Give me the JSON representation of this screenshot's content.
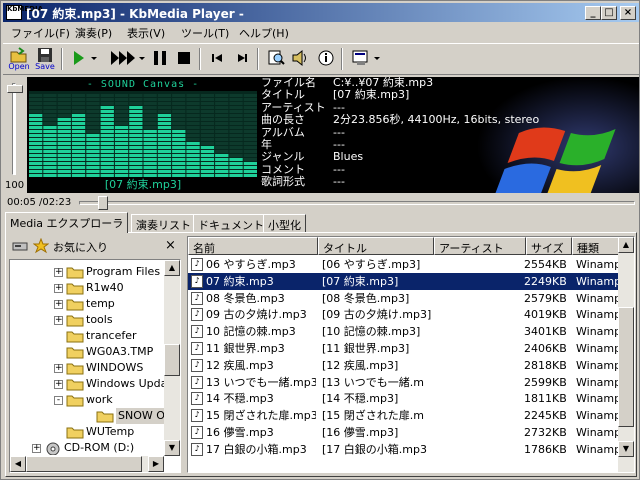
{
  "window": {
    "title": "[07 約束.mp3] - KbMedia Player -",
    "icon_text": "KbMEDIA",
    "buttons": {
      "minimize": "_",
      "maximize": "□",
      "close": "×"
    }
  },
  "menu": [
    "ファイル(F)",
    "演奏(P)",
    "表示(V)",
    "ツール(T)",
    "ヘルプ(H)"
  ],
  "toolbar": {
    "open_label": "Open",
    "save_label": "Save",
    "icons": [
      "open-folder-icon",
      "save-disk-icon",
      "play-icon",
      "fast-forward-icon",
      "pause-icon",
      "stop-icon",
      "previous-track-icon",
      "next-track-icon",
      "search-file-icon",
      "speaker-icon",
      "info-icon",
      "dropdown-menu-icon"
    ]
  },
  "volume": {
    "level_label": "100",
    "level": 1.0
  },
  "visualizer": {
    "title": "- SOUND Canvas -",
    "track": "[07 約束.mp3]",
    "bar_color": "#1fd19a",
    "bars": [
      0.78,
      0.62,
      0.7,
      0.78,
      0.5,
      0.86,
      0.62,
      0.86,
      0.58,
      0.78,
      0.58,
      0.44,
      0.36,
      0.3,
      0.22,
      0.18
    ]
  },
  "info": {
    "rows": [
      {
        "key": "ファイル名",
        "value": "C:¥..¥07 約束.mp3"
      },
      {
        "key": "タイトル",
        "value": "[07 約束.mp3]"
      },
      {
        "key": "アーティスト",
        "value": "---"
      },
      {
        "key": "曲の長さ",
        "value": "2分23.856秒, 44100Hz, 16bits, stereo"
      },
      {
        "key": "アルバム",
        "value": "---"
      },
      {
        "key": "年",
        "value": "---"
      },
      {
        "key": "ジャンル",
        "value": "Blues"
      },
      {
        "key": "コメント",
        "value": "---"
      },
      {
        "key": "歌詞形式",
        "value": "---"
      }
    ]
  },
  "seek": {
    "time": "00:05 /02:23",
    "position": 0.035
  },
  "tabs": [
    {
      "label": "Media エクスプローラ",
      "active": true
    },
    {
      "label": "演奏リスト",
      "active": false
    },
    {
      "label": "ドキュメント",
      "active": false
    },
    {
      "label": "小型化",
      "active": false
    }
  ],
  "favorites": {
    "title": "お気に入り",
    "close": "×"
  },
  "tree": [
    {
      "label": "Program Files",
      "level": 1,
      "expander": "+"
    },
    {
      "label": "R1w40",
      "level": 1,
      "expander": "+"
    },
    {
      "label": "temp",
      "level": 1,
      "expander": "+"
    },
    {
      "label": "tools",
      "level": 1,
      "expander": "+"
    },
    {
      "label": "trancefer",
      "level": 1,
      "expander": ""
    },
    {
      "label": "WG0A3.TMP",
      "level": 1,
      "expander": ""
    },
    {
      "label": "WINDOWS",
      "level": 1,
      "expander": "+"
    },
    {
      "label": "Windows Update",
      "level": 1,
      "expander": "+"
    },
    {
      "label": "work",
      "level": 1,
      "expander": "-"
    },
    {
      "label": "SNOW ORI",
      "level": 2,
      "expander": "",
      "selected": true
    },
    {
      "label": "WUTemp",
      "level": 1,
      "expander": ""
    },
    {
      "label": "CD-ROM (D:)",
      "level": 0,
      "expander": "+"
    }
  ],
  "filelist": {
    "columns": [
      "名前",
      "タイトル",
      "アーティスト",
      "サイズ",
      "種類"
    ],
    "rows": [
      {
        "name": "06 やすらぎ.mp3",
        "title": "[06 やすらぎ.mp3]",
        "artist": "",
        "size": "2554KB",
        "type": "Winamp"
      },
      {
        "name": "07 約束.mp3",
        "title": "[07 約束.mp3]",
        "artist": "",
        "size": "2249KB",
        "type": "Winamp",
        "selected": true
      },
      {
        "name": "08 冬景色.mp3",
        "title": "[08 冬景色.mp3]",
        "artist": "",
        "size": "2579KB",
        "type": "Winamp"
      },
      {
        "name": "09 古の夕焼け.mp3",
        "title": "[09 古の夕焼け.mp3]",
        "artist": "",
        "size": "4019KB",
        "type": "Winamp"
      },
      {
        "name": "10 記憶の棘.mp3",
        "title": "[10 記憶の棘.mp3]",
        "artist": "",
        "size": "3401KB",
        "type": "Winamp"
      },
      {
        "name": "11 銀世界.mp3",
        "title": "[11 銀世界.mp3]",
        "artist": "",
        "size": "2406KB",
        "type": "Winamp"
      },
      {
        "name": "12 疾風.mp3",
        "title": "[12 疾風.mp3]",
        "artist": "",
        "size": "2818KB",
        "type": "Winamp"
      },
      {
        "name": "13 いつでも一緒.mp3",
        "title": "[13 いつでも一緒.m",
        "artist": "",
        "size": "2599KB",
        "type": "Winamp"
      },
      {
        "name": "14 不穏.mp3",
        "title": "[14 不穏.mp3]",
        "artist": "",
        "size": "1811KB",
        "type": "Winamp"
      },
      {
        "name": "15 閉ざされた扉.mp3",
        "title": "[15 閉ざされた扉.m",
        "artist": "",
        "size": "2245KB",
        "type": "Winamp"
      },
      {
        "name": "16 儚雪.mp3",
        "title": "[16 儚雪.mp3]",
        "artist": "",
        "size": "2732KB",
        "type": "Winamp"
      },
      {
        "name": "17 白銀の小箱.mp3",
        "title": "[17 白銀の小箱.mp3",
        "artist": "",
        "size": "1786KB",
        "type": "Winamp"
      }
    ]
  }
}
